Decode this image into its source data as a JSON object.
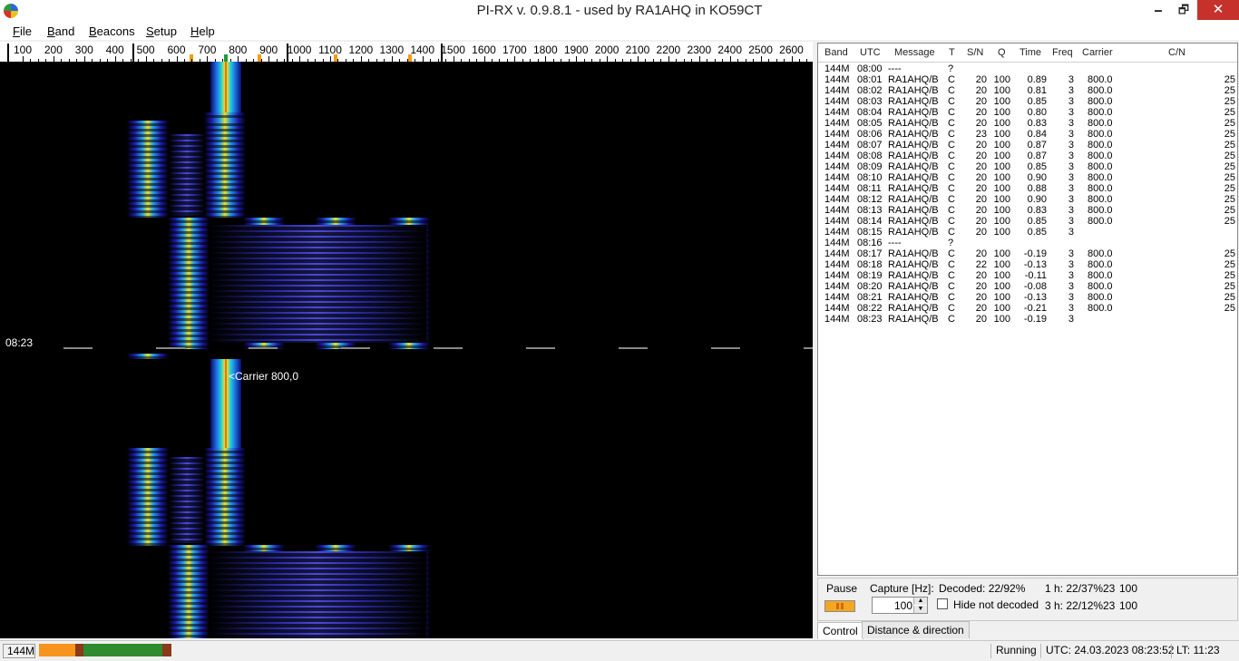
{
  "window": {
    "title": "PI-RX v. 0.9.8.1 - used by RA1AHQ in KO59CT",
    "minimize": "🗕",
    "restore": "🗗",
    "close": "✕"
  },
  "menu": [
    "File",
    "Band",
    "Beacons",
    "Setup",
    "Help"
  ],
  "ruler": {
    "labels": [
      "100",
      "200",
      "300",
      "400",
      "500",
      "600",
      "700",
      "800",
      "900",
      "1000",
      "1100",
      "1200",
      "1300",
      "1400",
      "1500",
      "1600",
      "1700",
      "1800",
      "1900",
      "2000",
      "2100",
      "2200",
      "2300",
      "2400",
      "2500",
      "2600"
    ]
  },
  "waterfall": {
    "time_label": "08:23",
    "carrier_label": "<Carrier 800,0"
  },
  "log": {
    "headers": [
      "Band",
      "UTC",
      "Message",
      "T",
      "S/N",
      "Q",
      "Time",
      "Freq",
      "Carrier",
      "C/N"
    ],
    "rows": [
      [
        "144M",
        "08:00",
        "----",
        "?",
        "",
        "",
        "",
        "",
        "",
        ""
      ],
      [
        "144M",
        "08:01",
        "RA1AHQ/B",
        "C",
        "20",
        "100",
        "0.89",
        "3",
        "800.0",
        "25"
      ],
      [
        "144M",
        "08:02",
        "RA1AHQ/B",
        "C",
        "20",
        "100",
        "0.81",
        "3",
        "800.0",
        "25"
      ],
      [
        "144M",
        "08:03",
        "RA1AHQ/B",
        "C",
        "20",
        "100",
        "0.85",
        "3",
        "800.0",
        "25"
      ],
      [
        "144M",
        "08:04",
        "RA1AHQ/B",
        "C",
        "20",
        "100",
        "0.80",
        "3",
        "800.0",
        "25"
      ],
      [
        "144M",
        "08:05",
        "RA1AHQ/B",
        "C",
        "20",
        "100",
        "0.83",
        "3",
        "800.0",
        "25"
      ],
      [
        "144M",
        "08:06",
        "RA1AHQ/B",
        "C",
        "23",
        "100",
        "0.84",
        "3",
        "800.0",
        "25"
      ],
      [
        "144M",
        "08:07",
        "RA1AHQ/B",
        "C",
        "20",
        "100",
        "0.87",
        "3",
        "800.0",
        "25"
      ],
      [
        "144M",
        "08:08",
        "RA1AHQ/B",
        "C",
        "20",
        "100",
        "0.87",
        "3",
        "800.0",
        "25"
      ],
      [
        "144M",
        "08:09",
        "RA1AHQ/B",
        "C",
        "20",
        "100",
        "0.85",
        "3",
        "800.0",
        "25"
      ],
      [
        "144M",
        "08:10",
        "RA1AHQ/B",
        "C",
        "20",
        "100",
        "0.90",
        "3",
        "800.0",
        "25"
      ],
      [
        "144M",
        "08:11",
        "RA1AHQ/B",
        "C",
        "20",
        "100",
        "0.88",
        "3",
        "800.0",
        "25"
      ],
      [
        "144M",
        "08:12",
        "RA1AHQ/B",
        "C",
        "20",
        "100",
        "0.90",
        "3",
        "800.0",
        "25"
      ],
      [
        "144M",
        "08:13",
        "RA1AHQ/B",
        "C",
        "20",
        "100",
        "0.83",
        "3",
        "800.0",
        "25"
      ],
      [
        "144M",
        "08:14",
        "RA1AHQ/B",
        "C",
        "20",
        "100",
        "0.85",
        "3",
        "800.0",
        "25"
      ],
      [
        "144M",
        "08:15",
        "RA1AHQ/B",
        "C",
        "20",
        "100",
        "0.85",
        "3",
        "",
        ""
      ],
      [
        "144M",
        "08:16",
        "----",
        "?",
        "",
        "",
        "",
        "",
        "",
        ""
      ],
      [
        "144M",
        "08:17",
        "RA1AHQ/B",
        "C",
        "20",
        "100",
        "-0.19",
        "3",
        "800.0",
        "25"
      ],
      [
        "144M",
        "08:18",
        "RA1AHQ/B",
        "C",
        "22",
        "100",
        "-0.13",
        "3",
        "800.0",
        "25"
      ],
      [
        "144M",
        "08:19",
        "RA1AHQ/B",
        "C",
        "20",
        "100",
        "-0.11",
        "3",
        "800.0",
        "25"
      ],
      [
        "144M",
        "08:20",
        "RA1AHQ/B",
        "C",
        "20",
        "100",
        "-0.08",
        "3",
        "800.0",
        "25"
      ],
      [
        "144M",
        "08:21",
        "RA1AHQ/B",
        "C",
        "20",
        "100",
        "-0.13",
        "3",
        "800.0",
        "25"
      ],
      [
        "144M",
        "08:22",
        "RA1AHQ/B",
        "C",
        "20",
        "100",
        "-0.21",
        "3",
        "800.0",
        "25"
      ],
      [
        "144M",
        "08:23",
        "RA1AHQ/B",
        "C",
        "20",
        "100",
        "-0.19",
        "3",
        "",
        ""
      ]
    ]
  },
  "control": {
    "pause_label": "Pause",
    "capture_label": "Capture [Hz]:",
    "capture_value": "100",
    "decoded_label": "Decoded: 22/92%",
    "hide_label": "Hide not decoded",
    "h1_label": "1 h: 22/37%",
    "h1_a": "23",
    "h1_b": "100",
    "h3_label": "3 h: 22/12%",
    "h3_a": "23",
    "h3_b": "100"
  },
  "tabs": [
    "Control",
    "Distance & direction"
  ],
  "status": {
    "band": "144M",
    "state": "Running",
    "utc": "UTC: 24.03.2023 08:23:52",
    "lt": "LT: 11:23",
    "level_colors": [
      "#f7941d",
      "#8b3a1a",
      "#2e8b2e",
      "#8b3a1a"
    ]
  }
}
